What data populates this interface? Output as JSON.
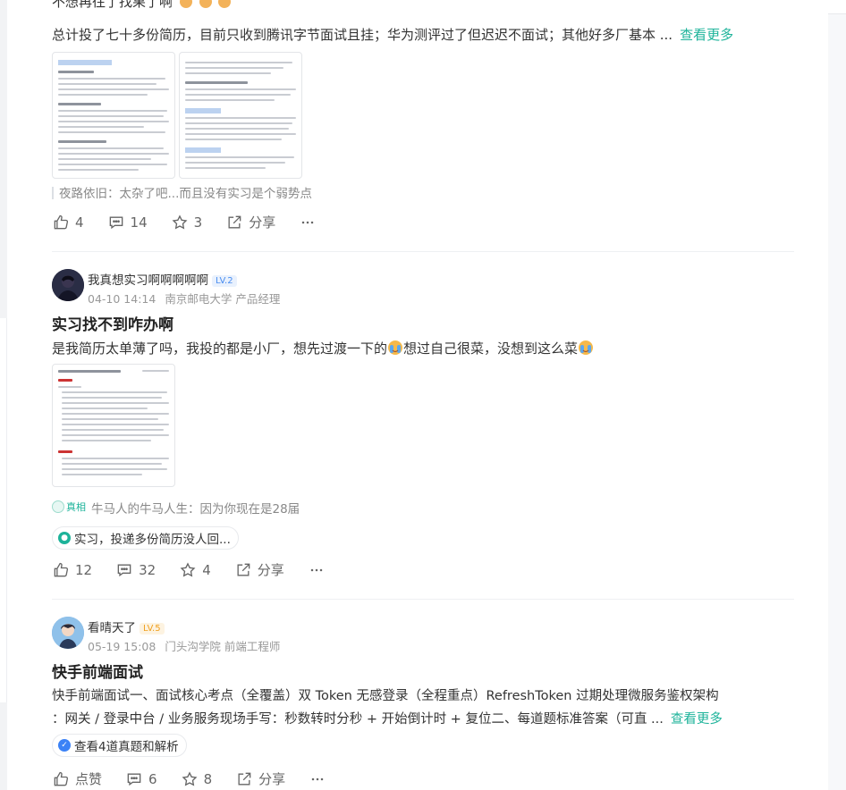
{
  "post1": {
    "top_line": "不想再往了找果了啊",
    "text": "总计投了七十多份简历，目前只收到腾讯字节面试且挂；华为测评过了但迟迟不面试；其他好多厂基本 ...",
    "more": "查看更多",
    "comment_author": "夜路依旧",
    "comment_sep": "：",
    "comment_text": "太杂了吧...而且没有实习是个弱势点",
    "likes": "4",
    "comments": "14",
    "stars": "3",
    "share": "分享"
  },
  "post2": {
    "username": "我真想实习啊啊啊啊啊",
    "level": "LV.2",
    "date": "04-10 14:14",
    "school": "南京邮电大学",
    "role": "产品经理",
    "title": "实习找不到咋办啊",
    "text_a": "是我简历太单薄了吗，我投的都是小厂，想先过渡一下的",
    "text_b": "想过自己很菜，没想到这么菜",
    "comment_badge": "真相",
    "comment_author": "牛马人的牛马人生",
    "comment_sep": "：",
    "comment_text": "因为你现在是28届",
    "chip": "实习，投递多份简历没人回...",
    "likes": "12",
    "comments": "32",
    "stars": "4",
    "share": "分享"
  },
  "post3": {
    "username": "看晴天了",
    "level": "LV.5",
    "date": "05-19 15:08",
    "school": "门头沟学院",
    "role": "前端工程师",
    "title": "快手前端面试",
    "text_line1": "快手前端面试一、面试核心考点（全覆盖）双 Token 无感登录（全程重点）RefreshToken 过期处理微服务鉴权架构",
    "text_line2": "：网关 / 登录中台 / 业务服务现场手写：秒数转时分秒 + 开始倒计时 + 复位二、每道题标准答案（可直 ...",
    "more": "查看更多",
    "chip": "查看4道真题和解析",
    "likes": "点赞",
    "comments": "6",
    "stars": "8",
    "share": "分享"
  },
  "colors": {
    "accent": "#1db39a",
    "lv2": "#4a8ef0",
    "lv5": "#f0a020"
  },
  "icons": [
    "thumbs-up-icon",
    "comment-icon",
    "star-icon",
    "share-icon",
    "more-icon"
  ]
}
